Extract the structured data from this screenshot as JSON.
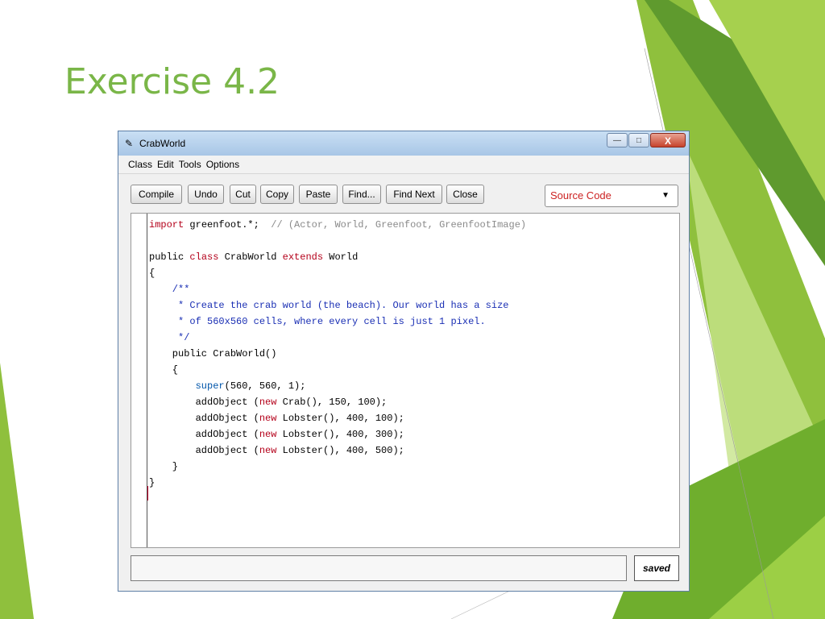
{
  "slide": {
    "title": "Exercise 4.2"
  },
  "window": {
    "title": "CrabWorld",
    "controls": {
      "minimize": "—",
      "maximize": "□",
      "close": "X"
    }
  },
  "menu": [
    "Class",
    "Edit",
    "Tools",
    "Options"
  ],
  "toolbar": {
    "buttons": [
      "Compile",
      "Undo",
      "Cut",
      "Copy",
      "Paste",
      "Find...",
      "Find Next",
      "Close"
    ],
    "view_select": "Source Code"
  },
  "code": {
    "l1_kw": "import",
    "l1_text": " greenfoot.*;",
    "l1_comment": "  // (Actor, World, Greenfoot, GreenfootImage)",
    "l3_a": "public ",
    "l3_kw1": "class",
    "l3_b": " CrabWorld ",
    "l3_kw2": "extends",
    "l3_c": " World",
    "l4": "{",
    "jd1": "    /**",
    "jd2": "     * Create the crab world (the beach). Our world has a size",
    "jd3": "     * of 560x560 cells, where every cell is just 1 pixel.",
    "jd4": "     */",
    "ctor": "    public CrabWorld()",
    "ob": "    {",
    "super_kw": "        super",
    "super_args": "(560, 560, 1);",
    "add1_a": "        addObject (",
    "add1_new": "new",
    "add1_b": " Crab(), 150, 100);",
    "add2_a": "        addObject (",
    "add2_new": "new",
    "add2_b": " Lobster(), 400, 100);",
    "add3_a": "        addObject (",
    "add3_new": "new",
    "add3_b": " Lobster(), 400, 300);",
    "add4_a": "        addObject (",
    "add4_new": "new",
    "add4_b": " Lobster(), 400, 500);",
    "cb": "    }",
    "end": "}"
  },
  "status": {
    "message": "",
    "saved": "saved"
  },
  "colors": {
    "title_green": "#7ab648",
    "keyword": "#b4001a",
    "javadoc": "#1a2fb4",
    "comment": "#8a8a8a"
  }
}
